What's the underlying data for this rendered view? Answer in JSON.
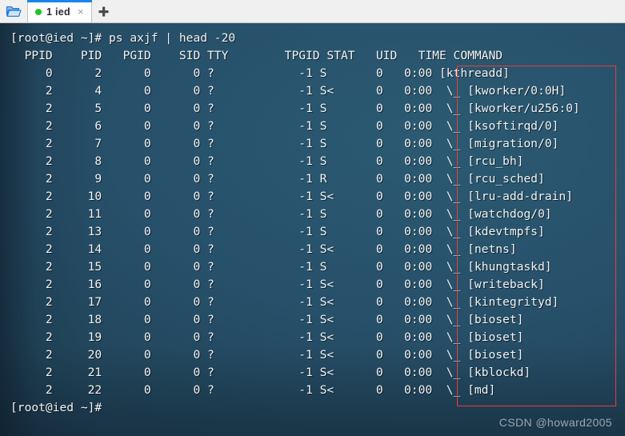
{
  "titlebar": {
    "folder_icon": "folder-open-icon",
    "new_tab_label": "+",
    "tabs": [
      {
        "status_dot": "green-status-dot",
        "label": "1 ied",
        "close_label": "×"
      }
    ]
  },
  "terminal": {
    "prompt": "[root@ied ~]#",
    "command": "ps axjf | head -20",
    "command_line": "[root@ied ~]# ps axjf | head -20",
    "final_prompt_line": "[root@ied ~]#",
    "columns": [
      "PPID",
      "PID",
      "PGID",
      "SID",
      "TTY",
      "TPGID",
      "STAT",
      "UID",
      "TIME",
      "COMMAND"
    ],
    "header_line": "  PPID    PID   PGID    SID TTY        TPGID STAT   UID   TIME COMMAND",
    "rows": [
      {
        "PPID": "0",
        "PID": "2",
        "PGID": "0",
        "SID": "0",
        "TTY": "?",
        "TPGID": "-1",
        "STAT": "S",
        "UID": "0",
        "TIME": "0:00",
        "COMMAND": "[kthreadd]"
      },
      {
        "PPID": "2",
        "PID": "4",
        "PGID": "0",
        "SID": "0",
        "TTY": "?",
        "TPGID": "-1",
        "STAT": "S<",
        "UID": "0",
        "TIME": "0:00",
        "COMMAND": " \\_ [kworker/0:0H]"
      },
      {
        "PPID": "2",
        "PID": "5",
        "PGID": "0",
        "SID": "0",
        "TTY": "?",
        "TPGID": "-1",
        "STAT": "S",
        "UID": "0",
        "TIME": "0:00",
        "COMMAND": " \\_ [kworker/u256:0]"
      },
      {
        "PPID": "2",
        "PID": "6",
        "PGID": "0",
        "SID": "0",
        "TTY": "?",
        "TPGID": "-1",
        "STAT": "S",
        "UID": "0",
        "TIME": "0:00",
        "COMMAND": " \\_ [ksoftirqd/0]"
      },
      {
        "PPID": "2",
        "PID": "7",
        "PGID": "0",
        "SID": "0",
        "TTY": "?",
        "TPGID": "-1",
        "STAT": "S",
        "UID": "0",
        "TIME": "0:00",
        "COMMAND": " \\_ [migration/0]"
      },
      {
        "PPID": "2",
        "PID": "8",
        "PGID": "0",
        "SID": "0",
        "TTY": "?",
        "TPGID": "-1",
        "STAT": "S",
        "UID": "0",
        "TIME": "0:00",
        "COMMAND": " \\_ [rcu_bh]"
      },
      {
        "PPID": "2",
        "PID": "9",
        "PGID": "0",
        "SID": "0",
        "TTY": "?",
        "TPGID": "-1",
        "STAT": "R",
        "UID": "0",
        "TIME": "0:00",
        "COMMAND": " \\_ [rcu_sched]"
      },
      {
        "PPID": "2",
        "PID": "10",
        "PGID": "0",
        "SID": "0",
        "TTY": "?",
        "TPGID": "-1",
        "STAT": "S<",
        "UID": "0",
        "TIME": "0:00",
        "COMMAND": " \\_ [lru-add-drain]"
      },
      {
        "PPID": "2",
        "PID": "11",
        "PGID": "0",
        "SID": "0",
        "TTY": "?",
        "TPGID": "-1",
        "STAT": "S",
        "UID": "0",
        "TIME": "0:00",
        "COMMAND": " \\_ [watchdog/0]"
      },
      {
        "PPID": "2",
        "PID": "13",
        "PGID": "0",
        "SID": "0",
        "TTY": "?",
        "TPGID": "-1",
        "STAT": "S",
        "UID": "0",
        "TIME": "0:00",
        "COMMAND": " \\_ [kdevtmpfs]"
      },
      {
        "PPID": "2",
        "PID": "14",
        "PGID": "0",
        "SID": "0",
        "TTY": "?",
        "TPGID": "-1",
        "STAT": "S<",
        "UID": "0",
        "TIME": "0:00",
        "COMMAND": " \\_ [netns]"
      },
      {
        "PPID": "2",
        "PID": "15",
        "PGID": "0",
        "SID": "0",
        "TTY": "?",
        "TPGID": "-1",
        "STAT": "S",
        "UID": "0",
        "TIME": "0:00",
        "COMMAND": " \\_ [khungtaskd]"
      },
      {
        "PPID": "2",
        "PID": "16",
        "PGID": "0",
        "SID": "0",
        "TTY": "?",
        "TPGID": "-1",
        "STAT": "S<",
        "UID": "0",
        "TIME": "0:00",
        "COMMAND": " \\_ [writeback]"
      },
      {
        "PPID": "2",
        "PID": "17",
        "PGID": "0",
        "SID": "0",
        "TTY": "?",
        "TPGID": "-1",
        "STAT": "S<",
        "UID": "0",
        "TIME": "0:00",
        "COMMAND": " \\_ [kintegrityd]"
      },
      {
        "PPID": "2",
        "PID": "18",
        "PGID": "0",
        "SID": "0",
        "TTY": "?",
        "TPGID": "-1",
        "STAT": "S<",
        "UID": "0",
        "TIME": "0:00",
        "COMMAND": " \\_ [bioset]"
      },
      {
        "PPID": "2",
        "PID": "19",
        "PGID": "0",
        "SID": "0",
        "TTY": "?",
        "TPGID": "-1",
        "STAT": "S<",
        "UID": "0",
        "TIME": "0:00",
        "COMMAND": " \\_ [bioset]"
      },
      {
        "PPID": "2",
        "PID": "20",
        "PGID": "0",
        "SID": "0",
        "TTY": "?",
        "TPGID": "-1",
        "STAT": "S<",
        "UID": "0",
        "TIME": "0:00",
        "COMMAND": " \\_ [bioset]"
      },
      {
        "PPID": "2",
        "PID": "21",
        "PGID": "0",
        "SID": "0",
        "TTY": "?",
        "TPGID": "-1",
        "STAT": "S<",
        "UID": "0",
        "TIME": "0:00",
        "COMMAND": " \\_ [kblockd]"
      },
      {
        "PPID": "2",
        "PID": "22",
        "PGID": "0",
        "SID": "0",
        "TTY": "?",
        "TPGID": "-1",
        "STAT": "S<",
        "UID": "0",
        "TIME": "0:00",
        "COMMAND": " \\_ [md]"
      }
    ]
  },
  "watermark": {
    "text": "CSDN @howard2005"
  },
  "colors": {
    "terminal_bg": "#27506a",
    "terminal_fg": "#f2f4f4",
    "highlight_box": "#ee3b3b",
    "tab_accent": "#1a84ea",
    "tab_status_dot": "#24c12a"
  }
}
